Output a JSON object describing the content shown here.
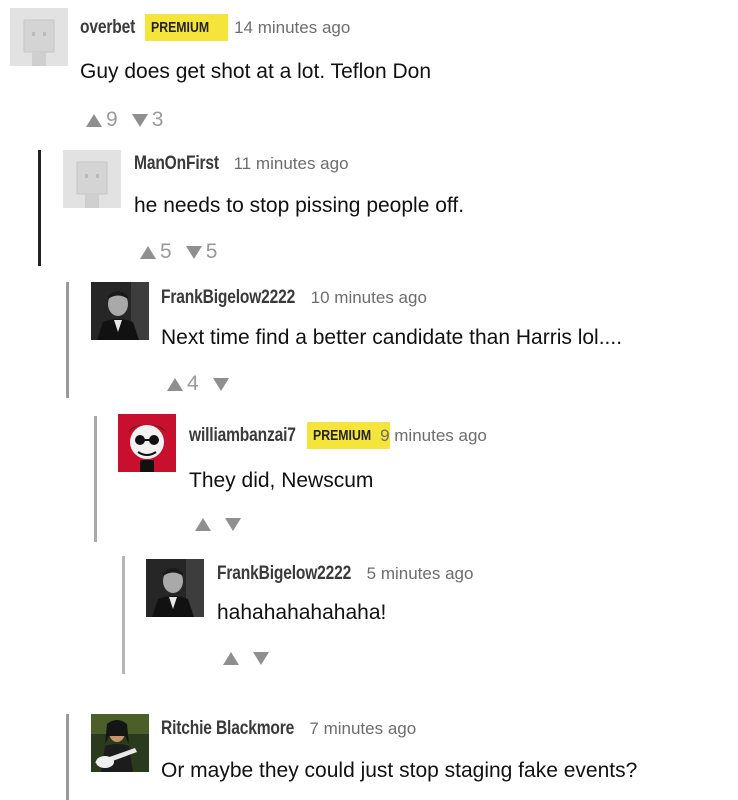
{
  "comments": [
    {
      "username": "overbet",
      "badge": "PREMIUM",
      "timestamp": "14 minutes ago",
      "text": "Guy does get shot at a lot. Teflon Don",
      "upvotes": "9",
      "downvotes": "3",
      "avatar": "default-avatar-icon"
    },
    {
      "username": "ManOnFirst",
      "timestamp": "11 minutes ago",
      "text": "he needs to stop pissing people off.",
      "upvotes": "5",
      "downvotes": "5",
      "avatar": "default-avatar-icon"
    },
    {
      "username": "FrankBigelow2222",
      "timestamp": "10 minutes ago",
      "text": "Next time find a better candidate than Harris lol....",
      "upvotes": "4",
      "downvotes": "",
      "avatar": "man-in-suit-photo"
    },
    {
      "username": "williambanzai7",
      "badge": "PREMIUM",
      "timestamp": "9 minutes ago",
      "text": "They did, Newscum",
      "upvotes": "",
      "downvotes": "",
      "avatar": "red-cartoon-face"
    },
    {
      "username": "FrankBigelow2222",
      "timestamp": "5 minutes ago",
      "text": "hahahahahahaha!",
      "upvotes": "",
      "downvotes": "",
      "avatar": "man-in-suit-photo"
    },
    {
      "username": "Ritchie Blackmore",
      "timestamp": "7 minutes ago",
      "text": "Or maybe they could just stop staging fake events?",
      "upvotes": "",
      "downvotes": "",
      "avatar": "guitarist-photo"
    }
  ],
  "colors": {
    "badge": "#f5e43a",
    "thread_line_dark": "#222222",
    "thread_line_light": "#b0b0b0",
    "vote_icon": "#8f8f8f"
  }
}
